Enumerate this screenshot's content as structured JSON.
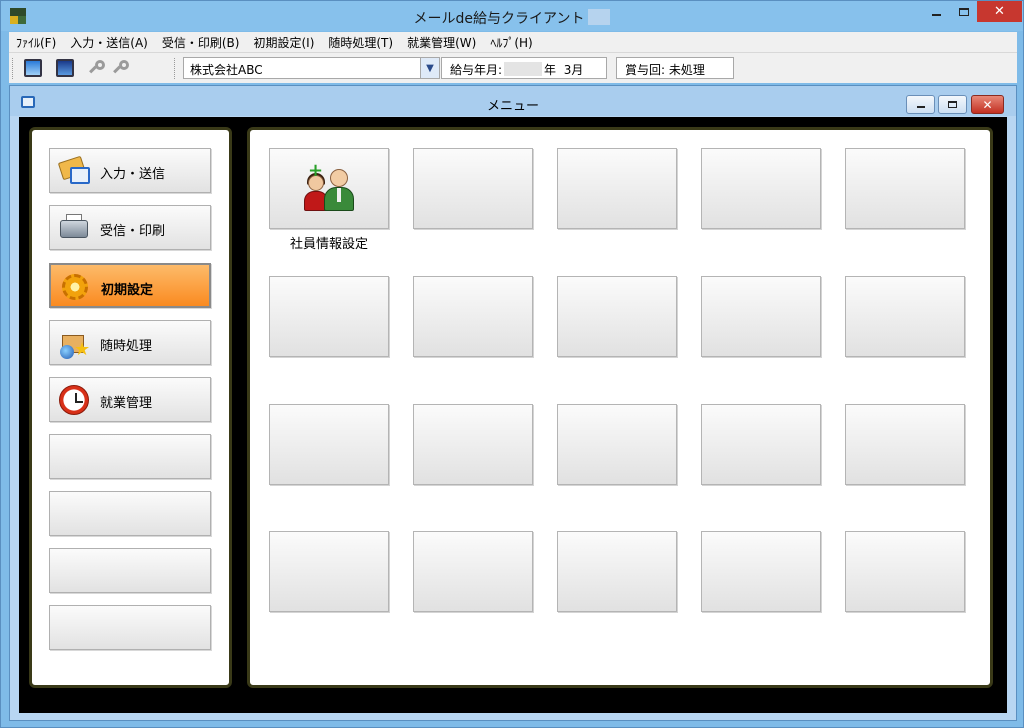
{
  "window": {
    "title": "メールde給与クライアント",
    "close_glyph": "✕"
  },
  "menubar": {
    "items": [
      {
        "label": "ﾌｧｲﾙ(F)"
      },
      {
        "label": "入力・送信(A)"
      },
      {
        "label": "受信・印刷(B)"
      },
      {
        "label": "初期設定(I)"
      },
      {
        "label": "随時処理(T)"
      },
      {
        "label": "就業管理(W)"
      },
      {
        "label": "ﾍﾙﾌﾟ(H)"
      }
    ]
  },
  "toolbar": {
    "company_select": "株式会社ABC",
    "dropdown_glyph": "▼",
    "salary_ym_label": "給与年月:",
    "salary_year_suffix": "年",
    "salary_month": "3月",
    "bonus_label": "賞与回:",
    "bonus_value": "未処理"
  },
  "menu_window": {
    "title": "メニュー",
    "close_glyph": "✕"
  },
  "nav": {
    "buttons": [
      {
        "label": "入力・送信",
        "icon": "mail-folder-icon",
        "active": false
      },
      {
        "label": "受信・印刷",
        "icon": "printer-icon",
        "active": false
      },
      {
        "label": "初期設定",
        "icon": "gear-icon",
        "active": true
      },
      {
        "label": "随時処理",
        "icon": "box-globe-icon",
        "active": false
      },
      {
        "label": "就業管理",
        "icon": "clock-icon",
        "active": false
      },
      {
        "label": ""
      },
      {
        "label": ""
      },
      {
        "label": ""
      },
      {
        "label": ""
      }
    ]
  },
  "tiles": {
    "items": [
      {
        "caption": "社員情報設定",
        "icon": "employee-icon"
      }
    ],
    "grid": {
      "cols": 5,
      "rows": 4
    }
  },
  "colors": {
    "active_nav": "#fa8a20",
    "panel_border": "#3a3a18",
    "title_bar": "#87c1ec"
  }
}
